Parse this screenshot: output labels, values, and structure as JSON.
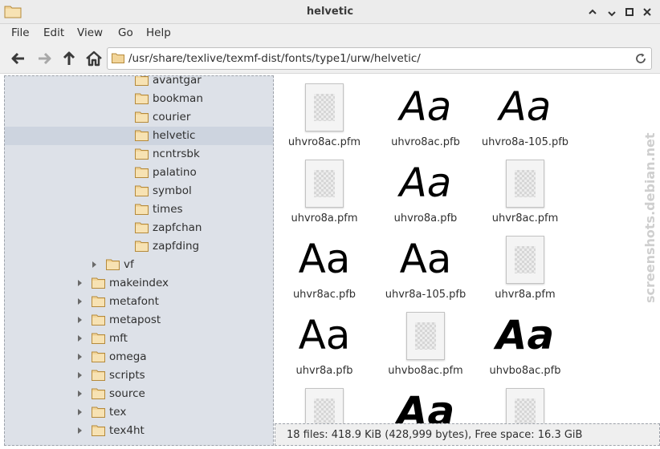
{
  "window": {
    "title": "helvetic"
  },
  "menu": [
    "File",
    "Edit",
    "View",
    "Go",
    "Help"
  ],
  "location": {
    "path": "/usr/share/texlive/texmf-dist/fonts/type1/urw/helvetic/"
  },
  "tree": [
    {
      "label": "avantgar",
      "expander": false,
      "selected": false
    },
    {
      "label": "bookman",
      "expander": false,
      "selected": false
    },
    {
      "label": "courier",
      "expander": false,
      "selected": false
    },
    {
      "label": "helvetic",
      "expander": false,
      "selected": true
    },
    {
      "label": "ncntrsbk",
      "expander": false,
      "selected": false
    },
    {
      "label": "palatino",
      "expander": false,
      "selected": false
    },
    {
      "label": "symbol",
      "expander": false,
      "selected": false
    },
    {
      "label": "times",
      "expander": false,
      "selected": false
    },
    {
      "label": "zapfchan",
      "expander": false,
      "selected": false
    },
    {
      "label": "zapfding",
      "expander": false,
      "selected": false
    },
    {
      "label": "vf",
      "expander": true,
      "selected": false
    },
    {
      "label": "makeindex",
      "expander": true,
      "selected": false
    },
    {
      "label": "metafont",
      "expander": true,
      "selected": false
    },
    {
      "label": "metapost",
      "expander": true,
      "selected": false
    },
    {
      "label": "mft",
      "expander": true,
      "selected": false
    },
    {
      "label": "omega",
      "expander": true,
      "selected": false
    },
    {
      "label": "scripts",
      "expander": true,
      "selected": false
    },
    {
      "label": "source",
      "expander": true,
      "selected": false
    },
    {
      "label": "tex",
      "expander": true,
      "selected": false
    },
    {
      "label": "tex4ht",
      "expander": true,
      "selected": false
    }
  ],
  "files": [
    {
      "name": "uhvro8ac.pfm",
      "kind": "generic"
    },
    {
      "name": "uhvro8ac.pfb",
      "kind": "font",
      "preview": "Aa",
      "style": "oblique"
    },
    {
      "name": "uhvro8a-105.pfb",
      "kind": "font",
      "preview": "Aa",
      "style": "oblique"
    },
    {
      "name": "uhvro8a.pfm",
      "kind": "generic"
    },
    {
      "name": "uhvro8a.pfb",
      "kind": "font",
      "preview": "Aa",
      "style": "oblique"
    },
    {
      "name": "uhvr8ac.pfm",
      "kind": "generic"
    },
    {
      "name": "uhvr8ac.pfb",
      "kind": "font",
      "preview": "Aa",
      "style": "regular"
    },
    {
      "name": "uhvr8a-105.pfb",
      "kind": "font",
      "preview": "Aa",
      "style": "regular"
    },
    {
      "name": "uhvr8a.pfm",
      "kind": "generic"
    },
    {
      "name": "uhvr8a.pfb",
      "kind": "font",
      "preview": "Aa",
      "style": "regular"
    },
    {
      "name": "uhvbo8ac.pfm",
      "kind": "generic"
    },
    {
      "name": "uhvbo8ac.pfb",
      "kind": "font",
      "preview": "Aa",
      "style": "bold-oblique"
    },
    {
      "name": "",
      "kind": "generic"
    },
    {
      "name": "",
      "kind": "font",
      "preview": "Aa",
      "style": "bold-oblique"
    },
    {
      "name": "",
      "kind": "generic"
    }
  ],
  "status": {
    "text": "18 files: 418.9  KiB (428,999 bytes), Free space: 16.3  GiB"
  },
  "watermark": {
    "text": "screenshots.debian.net"
  },
  "colors": {
    "folder": "#f2d59a",
    "folder_edge": "#b58a3b",
    "sidebar_bg": "#dde1e8",
    "selected_row": "#cdd4df"
  }
}
